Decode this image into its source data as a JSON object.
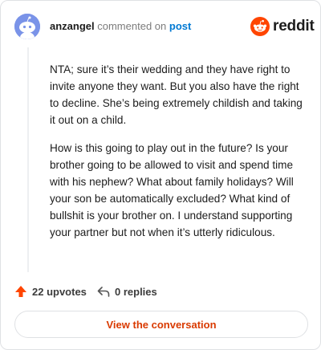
{
  "header": {
    "author": "anzangel",
    "action": "commented on",
    "post_link": "post"
  },
  "brand": {
    "wordmark": "reddit",
    "logo_icon": "reddit-snoo-icon",
    "accent": "#ff4500"
  },
  "avatar": {
    "icon": "snoo-avatar-icon",
    "background": "#7a93e8"
  },
  "comment": {
    "paragraphs": [
      "NTA; sure it’s their wedding and they have right to invite anyone they want. But you also have the right to decline. She’s being extremely childish and taking it out on a child.",
      "How is this going to play out in the future? Is your brother going to be allowed to visit and spend time with his nephew? What about family holidays? Will your son be automatically excluded? What kind of bullshit is your brother on. I understand supporting your partner but not when it’s utterly ridiculous."
    ]
  },
  "footer": {
    "upvotes_label": "22 upvotes",
    "upvote_icon": "upvote-arrow-icon",
    "replies_label": "0 replies",
    "reply_icon": "reply-arrow-icon",
    "view_button_label": "View the conversation"
  },
  "colors": {
    "link_blue": "#0079d3",
    "upvote_orange": "#ff4500",
    "button_text": "#d93a00"
  }
}
